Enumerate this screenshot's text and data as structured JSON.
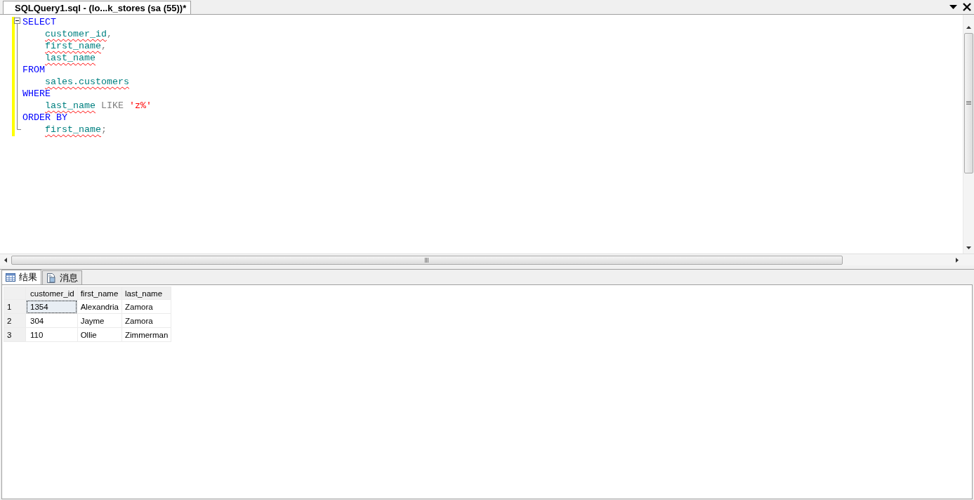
{
  "document_tab": {
    "title": "SQLQuery1.sql - (lo...k_stores (sa (55))*",
    "selected": true
  },
  "editor": {
    "lines": [
      {
        "indent": false,
        "tokens": [
          {
            "kind": "keyword",
            "text": "SELECT"
          }
        ]
      },
      {
        "indent": true,
        "tokens": [
          {
            "kind": "identifier",
            "text": "customer_id",
            "squiggle": true
          },
          {
            "kind": "punct",
            "text": ","
          }
        ]
      },
      {
        "indent": true,
        "tokens": [
          {
            "kind": "identifier",
            "text": "first_name",
            "squiggle": true
          },
          {
            "kind": "punct",
            "text": ","
          }
        ]
      },
      {
        "indent": true,
        "tokens": [
          {
            "kind": "identifier",
            "text": "last_name",
            "squiggle": true
          }
        ]
      },
      {
        "indent": false,
        "tokens": [
          {
            "kind": "keyword",
            "text": "FROM"
          }
        ]
      },
      {
        "indent": true,
        "tokens": [
          {
            "kind": "identifier",
            "text": "sales.customers",
            "squiggle": true
          }
        ]
      },
      {
        "indent": false,
        "tokens": [
          {
            "kind": "keyword",
            "text": "WHERE"
          }
        ]
      },
      {
        "indent": true,
        "tokens": [
          {
            "kind": "identifier",
            "text": "last_name",
            "squiggle": true
          },
          {
            "kind": "operator",
            "text": " LIKE "
          },
          {
            "kind": "string",
            "text": "'z%'"
          }
        ]
      },
      {
        "indent": false,
        "tokens": [
          {
            "kind": "keyword",
            "text": "ORDER BY"
          }
        ]
      },
      {
        "indent": true,
        "tokens": [
          {
            "kind": "identifier",
            "text": "first_name",
            "squiggle": true
          },
          {
            "kind": "punct",
            "text": ";"
          }
        ]
      }
    ]
  },
  "result_tabs": [
    {
      "label": "结果",
      "kind": "grid",
      "selected": true
    },
    {
      "label": "消息",
      "kind": "messages",
      "selected": false
    }
  ],
  "results": {
    "columns": [
      "customer_id",
      "first_name",
      "last_name"
    ],
    "rows": [
      {
        "number": "1",
        "cells": [
          "1354",
          "Alexandria",
          "Zamora"
        ],
        "focused": true
      },
      {
        "number": "2",
        "cells": [
          "304",
          "Jayme",
          "Zamora"
        ],
        "focused": false
      },
      {
        "number": "3",
        "cells": [
          "110",
          "Ollie",
          "Zimmerman"
        ],
        "focused": false
      }
    ]
  }
}
